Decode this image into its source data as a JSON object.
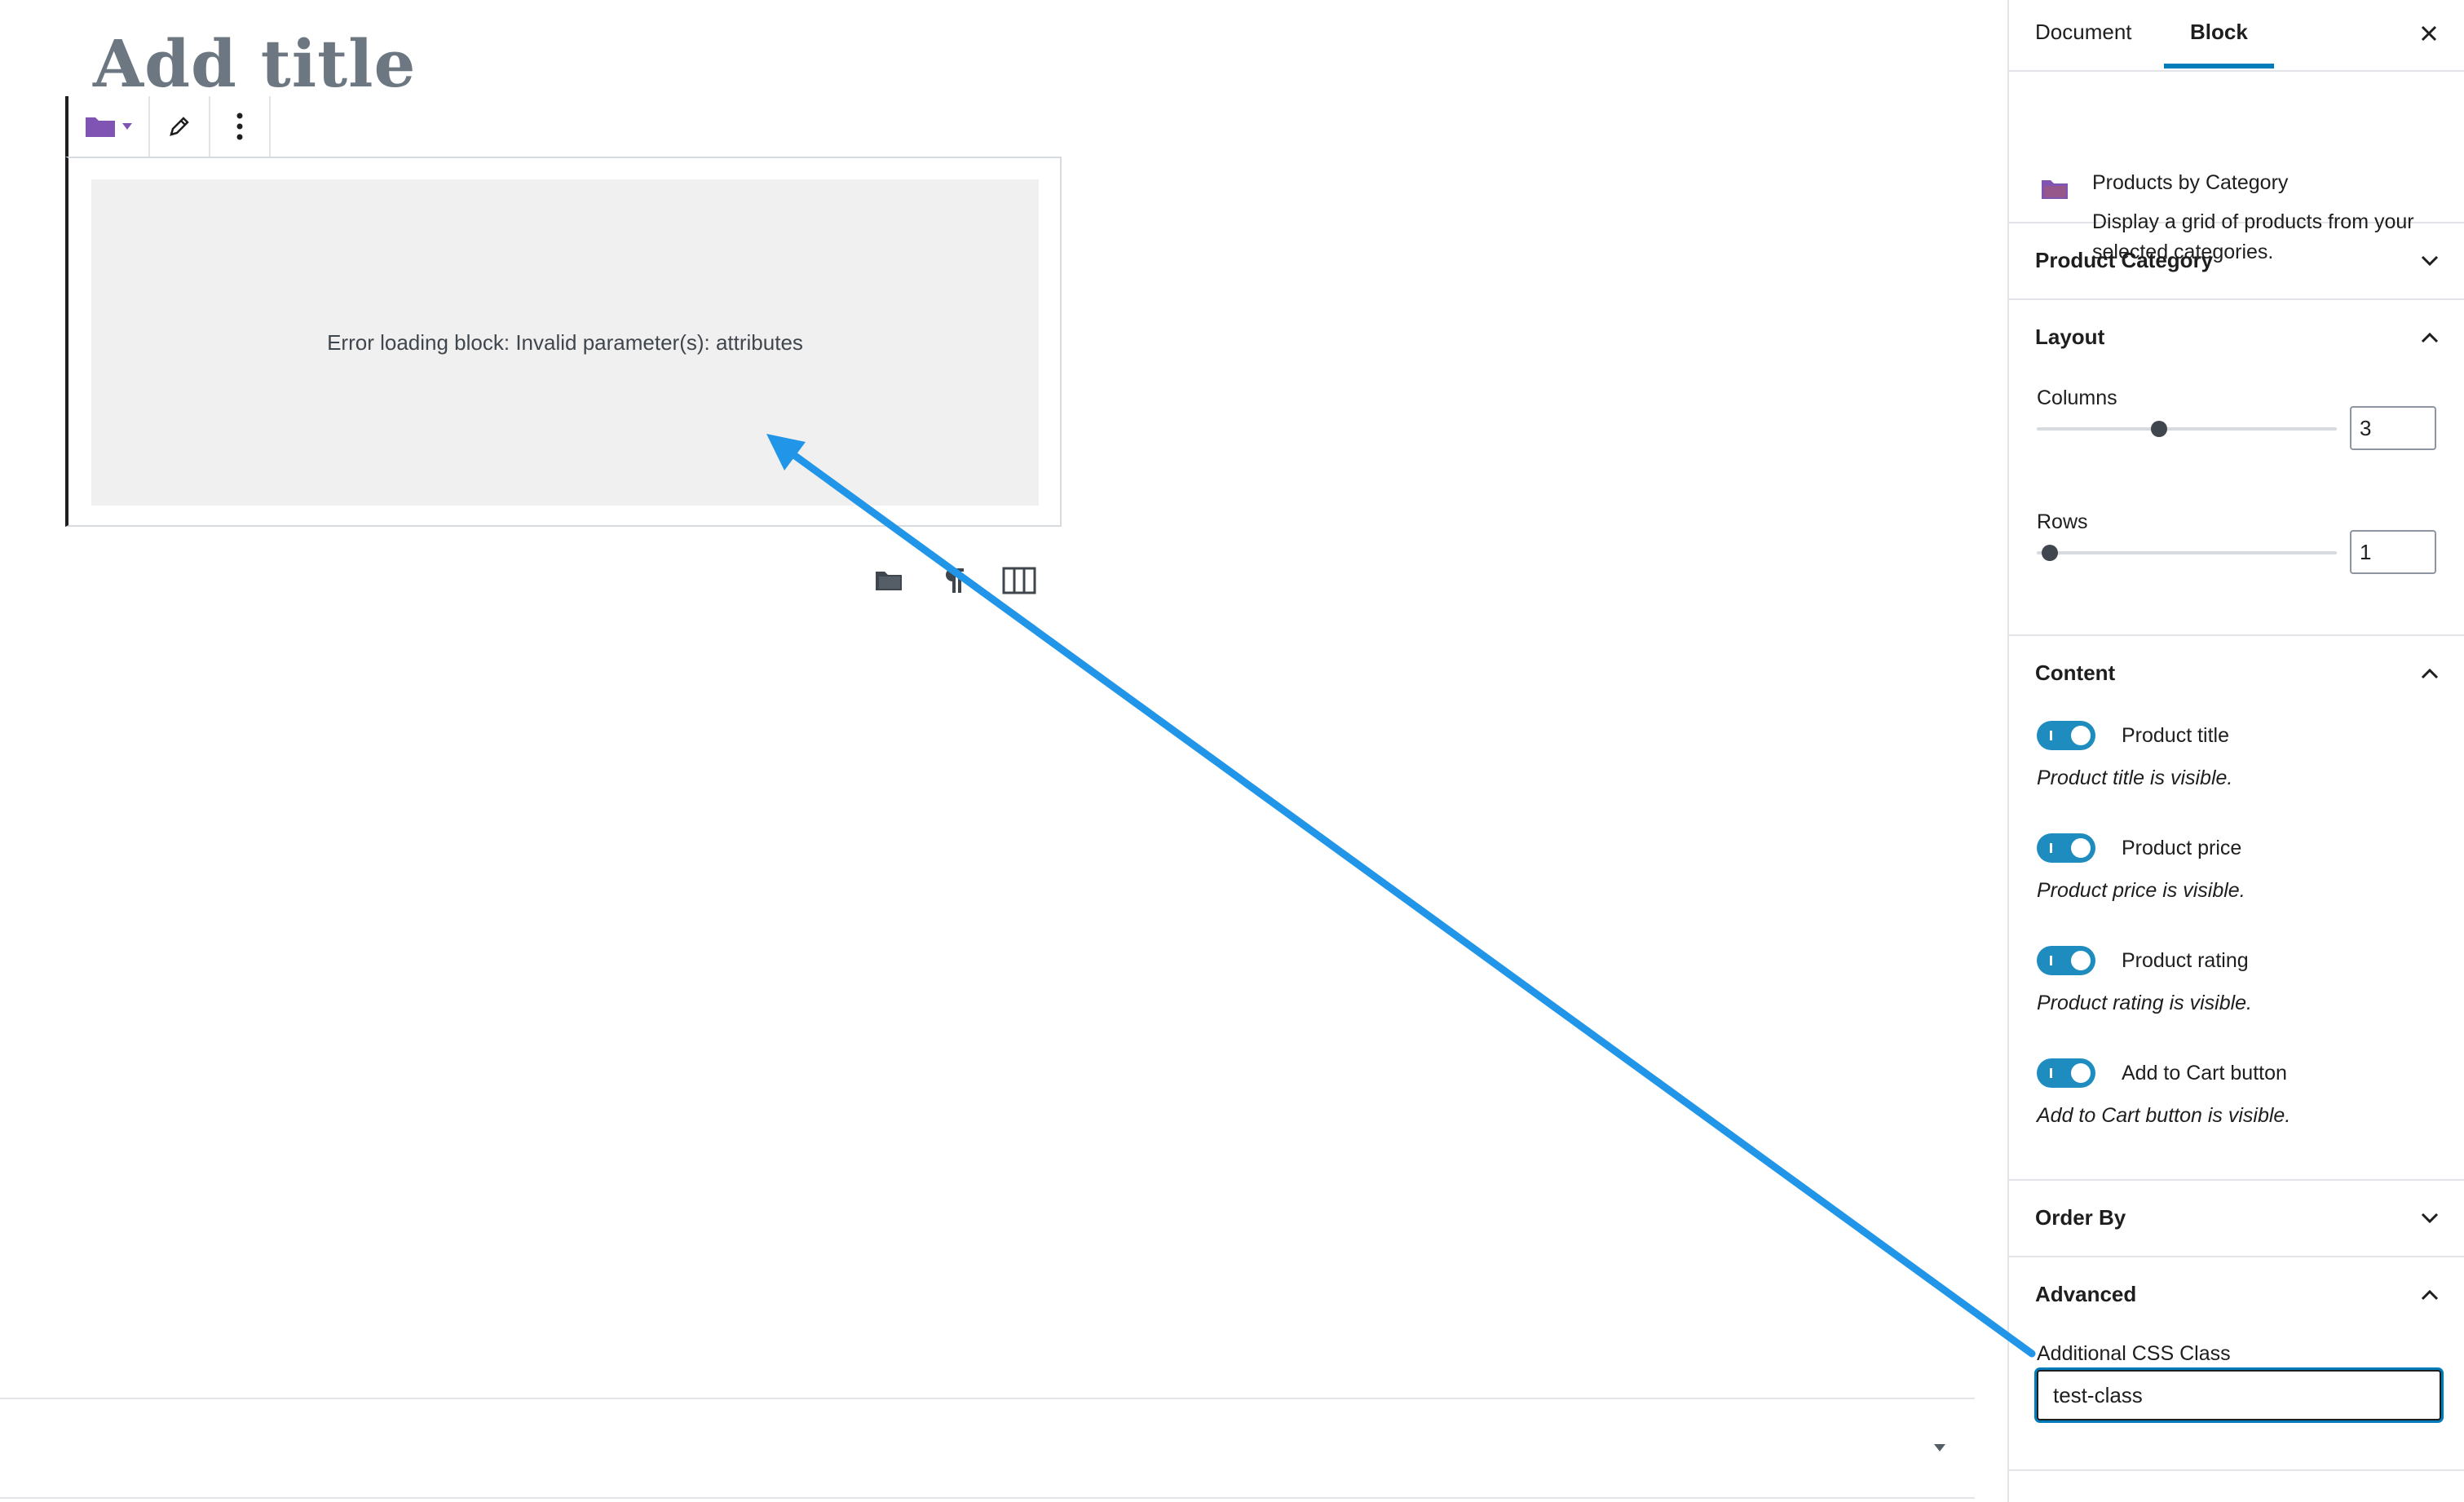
{
  "editor": {
    "title_placeholder": "Add title",
    "block_error": "Error loading block: Invalid parameter(s): attributes"
  },
  "sidebar": {
    "tabs": [
      {
        "label": "Document"
      },
      {
        "label": "Block"
      }
    ],
    "block_card": {
      "title": "Products by Category",
      "description": "Display a grid of products from your selected categories."
    },
    "panels": {
      "product_category": {
        "title": "Product Category"
      },
      "layout": {
        "title": "Layout",
        "columns_label": "Columns",
        "columns_value": "3",
        "rows_label": "Rows",
        "rows_value": "1"
      },
      "content": {
        "title": "Content",
        "toggles": [
          {
            "label": "Product title",
            "help": "Product title is visible."
          },
          {
            "label": "Product price",
            "help": "Product price is visible."
          },
          {
            "label": "Product rating",
            "help": "Product rating is visible."
          },
          {
            "label": "Add to Cart button",
            "help": "Add to Cart button is visible."
          }
        ]
      },
      "order_by": {
        "title": "Order By"
      },
      "advanced": {
        "title": "Advanced",
        "css_class_label": "Additional CSS Class",
        "css_class_value": "test-class"
      }
    }
  },
  "colors": {
    "accent": "#007cba",
    "toggle_on": "#1e8cbe",
    "woo_purple": "#7f54b3",
    "annotation_arrow": "#2196e8"
  },
  "icons": {
    "block_icon": "folder-icon",
    "close": "close-icon",
    "edit": "pencil-icon",
    "more": "more-vertical-icon"
  }
}
